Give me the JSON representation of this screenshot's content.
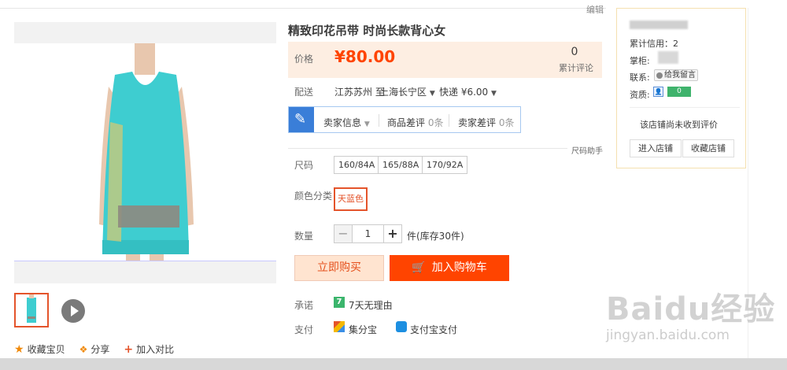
{
  "header": {
    "edit_link": "编辑"
  },
  "gallery": {
    "actions": [
      {
        "icon": "star-icon",
        "label": "收藏宝贝"
      },
      {
        "icon": "share-icon",
        "label": "分享"
      },
      {
        "icon": "plus-icon",
        "label": "加入对比"
      }
    ]
  },
  "product": {
    "title": "精致印花吊带 时尚长款背心女",
    "price_label": "价格",
    "price": "¥80.00",
    "review_count": "0",
    "review_label": "累计评论",
    "shipping": {
      "label": "配送",
      "from": "江苏苏州 至",
      "to": "上海长宁区",
      "fee": "快递 ¥6.00"
    },
    "seller": {
      "info": "卖家信息",
      "neg_product": "商品差评",
      "neg_product_count": "0条",
      "neg_seller": "卖家差评",
      "neg_seller_count": "0条"
    },
    "size_helper": "尺码助手",
    "size_label": "尺码",
    "sizes": [
      "160/84A",
      "165/88A",
      "170/92A"
    ],
    "color_label": "颜色分类",
    "color_selected": "天蓝色",
    "qty_label": "数量",
    "qty_value": "1",
    "qty_unit": "件(库存30件)",
    "buy_now": "立即购买",
    "add_cart": "加入购物车",
    "promise_label": "承诺",
    "promise_icon_text": "7",
    "promise_text": "7天无理由",
    "pay_label": "支付",
    "pay_methods": [
      "集分宝",
      "支付宝支付"
    ]
  },
  "shop": {
    "credit": "累计信用：2",
    "keeper": "掌柜:",
    "contact": "联系:",
    "msg_btn": "给我留言",
    "qualification": "资质:",
    "qual_badge": "0",
    "no_review": "该店铺尚未收到评价",
    "enter_shop": "进入店铺",
    "fav_shop": "收藏店铺"
  },
  "watermark": {
    "main": "Baidu经验",
    "sub": "jingyan.baidu.com"
  },
  "colors": {
    "accent": "#ff4400",
    "price_bg": "#fdeee2",
    "selected_border": "#e4542b",
    "dress": "#3ecdd0"
  }
}
